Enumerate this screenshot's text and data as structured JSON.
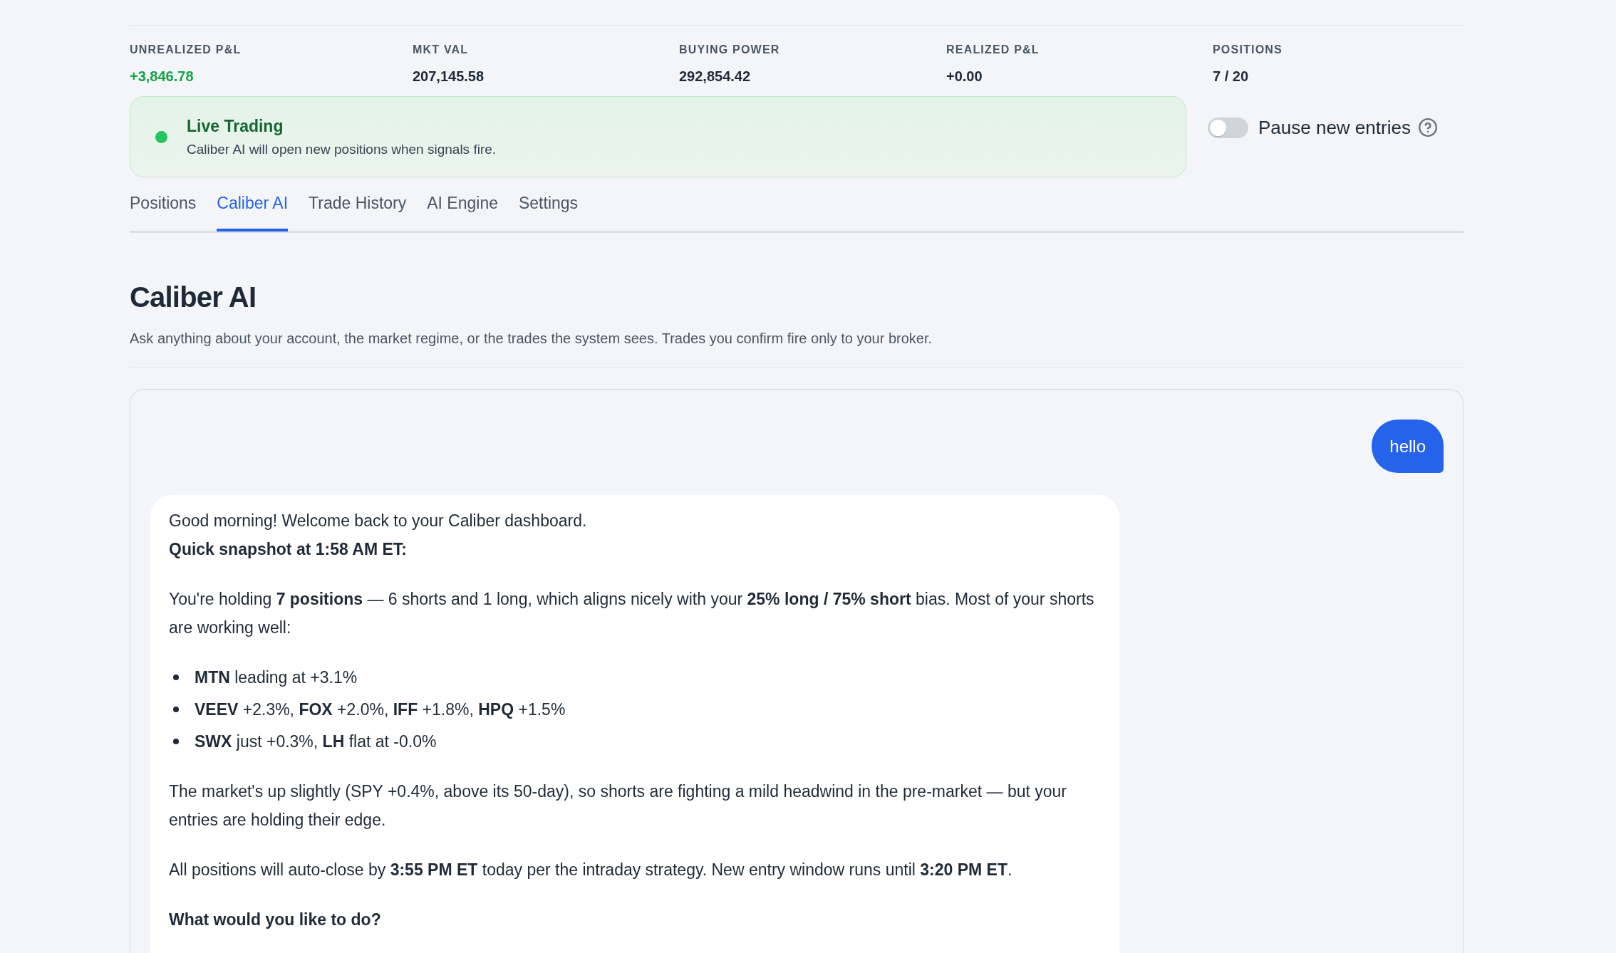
{
  "stats": [
    {
      "label": "UNREALIZED P&L",
      "value": "+3,846.78",
      "kind": "gain"
    },
    {
      "label": "MKT VAL",
      "value": "207,145.58",
      "kind": "plain"
    },
    {
      "label": "BUYING POWER",
      "value": "292,854.42",
      "kind": "plain"
    },
    {
      "label": "REALIZED P&L",
      "value": "+0.00",
      "kind": "plain"
    },
    {
      "label": "POSITIONS",
      "value": "7 / 20",
      "kind": "plain"
    }
  ],
  "status_banner": {
    "live": true,
    "title": "Live Trading",
    "message": "Caliber AI will open new positions when signals fire."
  },
  "pause_toggle": {
    "label": "Pause new entries",
    "on": false
  },
  "tabs": [
    {
      "label": "Positions",
      "selected": false
    },
    {
      "label": "Caliber AI",
      "selected": true
    },
    {
      "label": "Trade History",
      "selected": false
    },
    {
      "label": "AI Engine",
      "selected": false
    },
    {
      "label": "Settings",
      "selected": false
    }
  ],
  "section": {
    "title": "Caliber AI",
    "description": "Ask anything about your account, the market regime, or the trades the system sees. Trades you confirm fire only to your broker."
  },
  "chat": {
    "messages": [
      {
        "kind": "user",
        "text": "hello"
      },
      {
        "kind": "assistant",
        "blocks": [
          {
            "kind": "paragraph",
            "text": "Good morning! Welcome back to your Caliber dashboard.\n**Quick snapshot at 1:58 AM ET:**"
          },
          {
            "kind": "paragraph",
            "text": "You're holding **7 positions** — 6 shorts and 1 long, which aligns nicely with your **25% long / 75% short** bias. Most of your shorts are working well:"
          },
          {
            "kind": "list",
            "items": [
              "**MTN** leading at +3.1%",
              "**VEEV** +2.3%, **FOX** +2.0%, **IFF** +1.8%, **HPQ** +1.5%",
              "**SWX** just +0.3%, **LH** flat at -0.0%"
            ]
          },
          {
            "kind": "paragraph",
            "text": "The market's up slightly (SPY +0.4%, above its 50-day), so shorts are fighting a mild headwind in the pre-market — but your entries are holding their edge."
          },
          {
            "kind": "paragraph",
            "text": "All positions will auto-close by **3:55 PM ET** today per the intraday strategy. New entry window runs until **3:20 PM ET**."
          },
          {
            "kind": "question",
            "text": "What would you like to do?"
          }
        ]
      }
    ]
  }
}
